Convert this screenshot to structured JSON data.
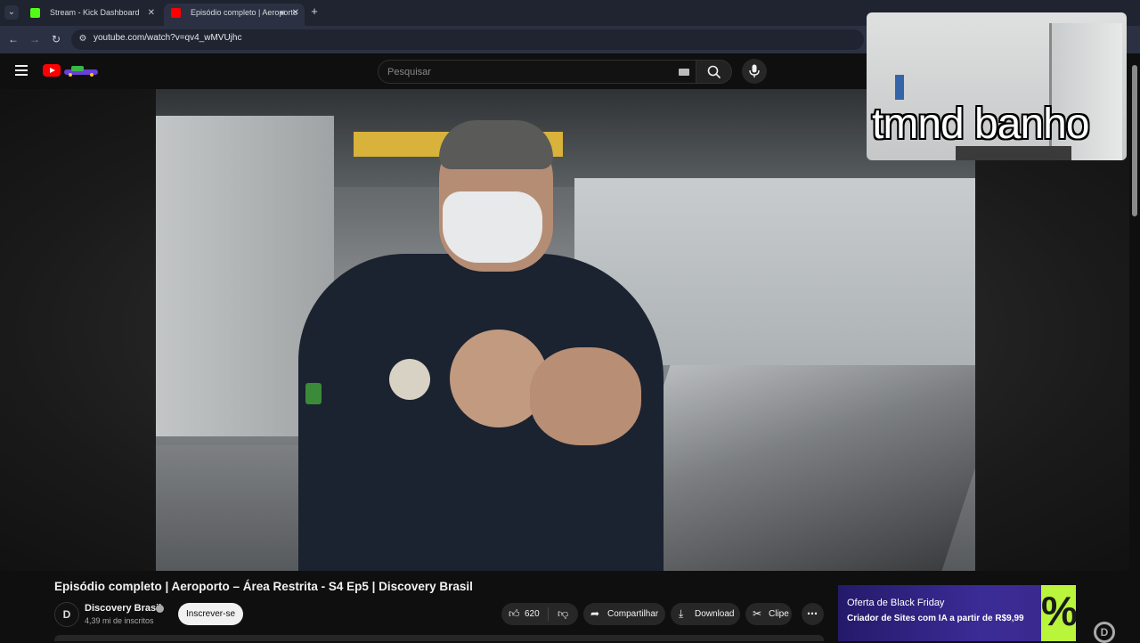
{
  "browser": {
    "tabs": [
      {
        "title": "Stream - Kick Dashboard",
        "favicon_color": "#53fc18"
      },
      {
        "title": "Episódio completo | Aeroporto",
        "favicon_color": "#ff0000"
      }
    ],
    "url": "youtube.com/watch?v=qv4_wMVUjhc"
  },
  "masthead": {
    "search_placeholder": "Pesquisar",
    "icons": [
      "menu-icon",
      "youtube-logo",
      "search-icon",
      "microphone-icon"
    ]
  },
  "overlay": {
    "text": "tmnd banho"
  },
  "video": {
    "title": "Episódio completo | Aeroporto – Área Restrita - S4 Ep5 | Discovery Brasil",
    "channel": {
      "name": "Discovery Brasil",
      "avatar_letter": "D",
      "subscribers": "4,39 mi de inscritos"
    },
    "subscribe_label": "Inscrever-se",
    "actions": {
      "likes": "620",
      "share_label": "Compartilhar",
      "download_label": "Download",
      "clip_label": "Clipe"
    }
  },
  "ad": {
    "line1": "Oferta de Black Friday",
    "line2": "Criador de Sites com IA a partir de R$9,99",
    "badge": "%"
  },
  "colors": {
    "accent": "#ff0000",
    "background": "#0f0f0f",
    "ad_bg": "#2f2283",
    "ad_badge": "#b9f53a"
  }
}
